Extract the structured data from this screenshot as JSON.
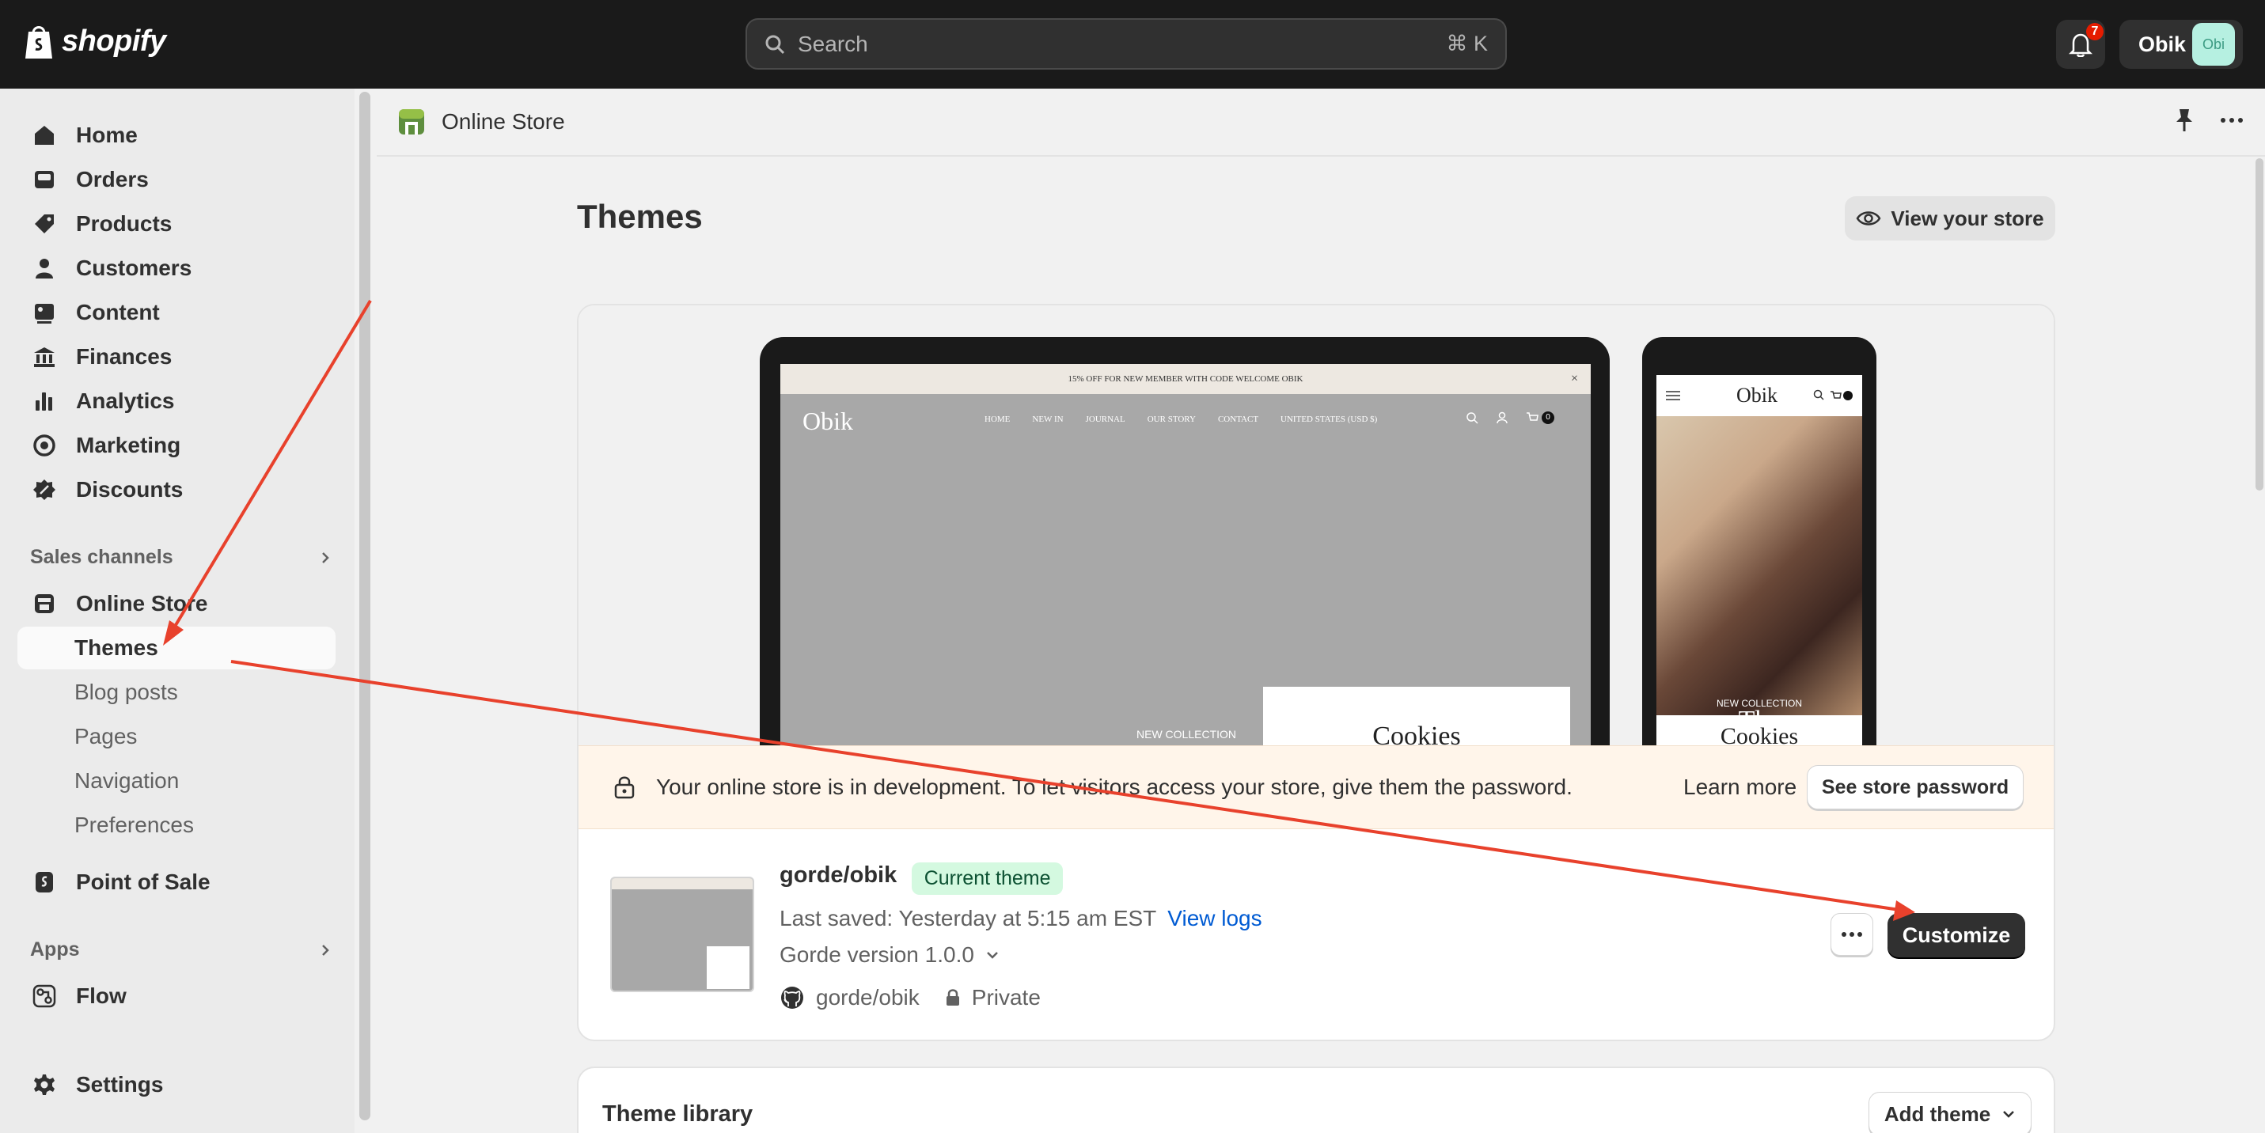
{
  "topbar": {
    "logo_text": "shopify",
    "search_placeholder": "Search",
    "search_shortcut": "⌘ K",
    "notifications_count": "7",
    "account_name": "Obik",
    "avatar_text": "Obi"
  },
  "sidebar": {
    "items": [
      {
        "label": "Home",
        "icon": "home-icon"
      },
      {
        "label": "Orders",
        "icon": "orders-icon"
      },
      {
        "label": "Products",
        "icon": "tag-icon"
      },
      {
        "label": "Customers",
        "icon": "person-icon"
      },
      {
        "label": "Content",
        "icon": "content-icon"
      },
      {
        "label": "Finances",
        "icon": "bank-icon"
      },
      {
        "label": "Analytics",
        "icon": "bar-chart-icon"
      },
      {
        "label": "Marketing",
        "icon": "target-icon"
      },
      {
        "label": "Discounts",
        "icon": "discount-icon"
      }
    ],
    "sales_channels_label": "Sales channels",
    "online_store_label": "Online Store",
    "online_store_sub": [
      "Themes",
      "Blog posts",
      "Pages",
      "Navigation",
      "Preferences"
    ],
    "point_of_sale_label": "Point of Sale",
    "apps_label": "Apps",
    "flow_label": "Flow",
    "settings_label": "Settings"
  },
  "header": {
    "title": "Online Store"
  },
  "main": {
    "page_title": "Themes",
    "view_store_label": "View your store",
    "preview": {
      "announcement": "15% OFF FOR NEW MEMBER WITH CODE WELCOME OBIK",
      "site_logo": "Obik",
      "site_nav": [
        "HOME",
        "NEW IN",
        "JOURNAL",
        "OUR STORY",
        "CONTACT",
        "UNITED STATES (USD $)"
      ],
      "cart_count": "0",
      "new_collection": "NEW COLLECTION",
      "cookies_title": "Cookies",
      "mobile_logo": "Obik",
      "mobile_the": "The"
    },
    "banner": {
      "text": "Your online store is in development. To let visitors access your store, give them the password.",
      "learn_more": "Learn more",
      "button": "See store password"
    },
    "theme": {
      "name": "gorde/obik",
      "badge": "Current theme",
      "last_saved": "Last saved: Yesterday at 5:15 am EST",
      "view_logs": "View logs",
      "version": "Gorde version 1.0.0",
      "repo": "gorde/obik",
      "visibility": "Private",
      "customize_label": "Customize"
    },
    "library": {
      "title": "Theme library",
      "add_theme_label": "Add theme"
    }
  },
  "colors": {
    "topbar": "#1a1a1a",
    "annotation_arrow": "#e8412c",
    "badge_bg": "#d4f9e0",
    "link": "#005bd3"
  }
}
